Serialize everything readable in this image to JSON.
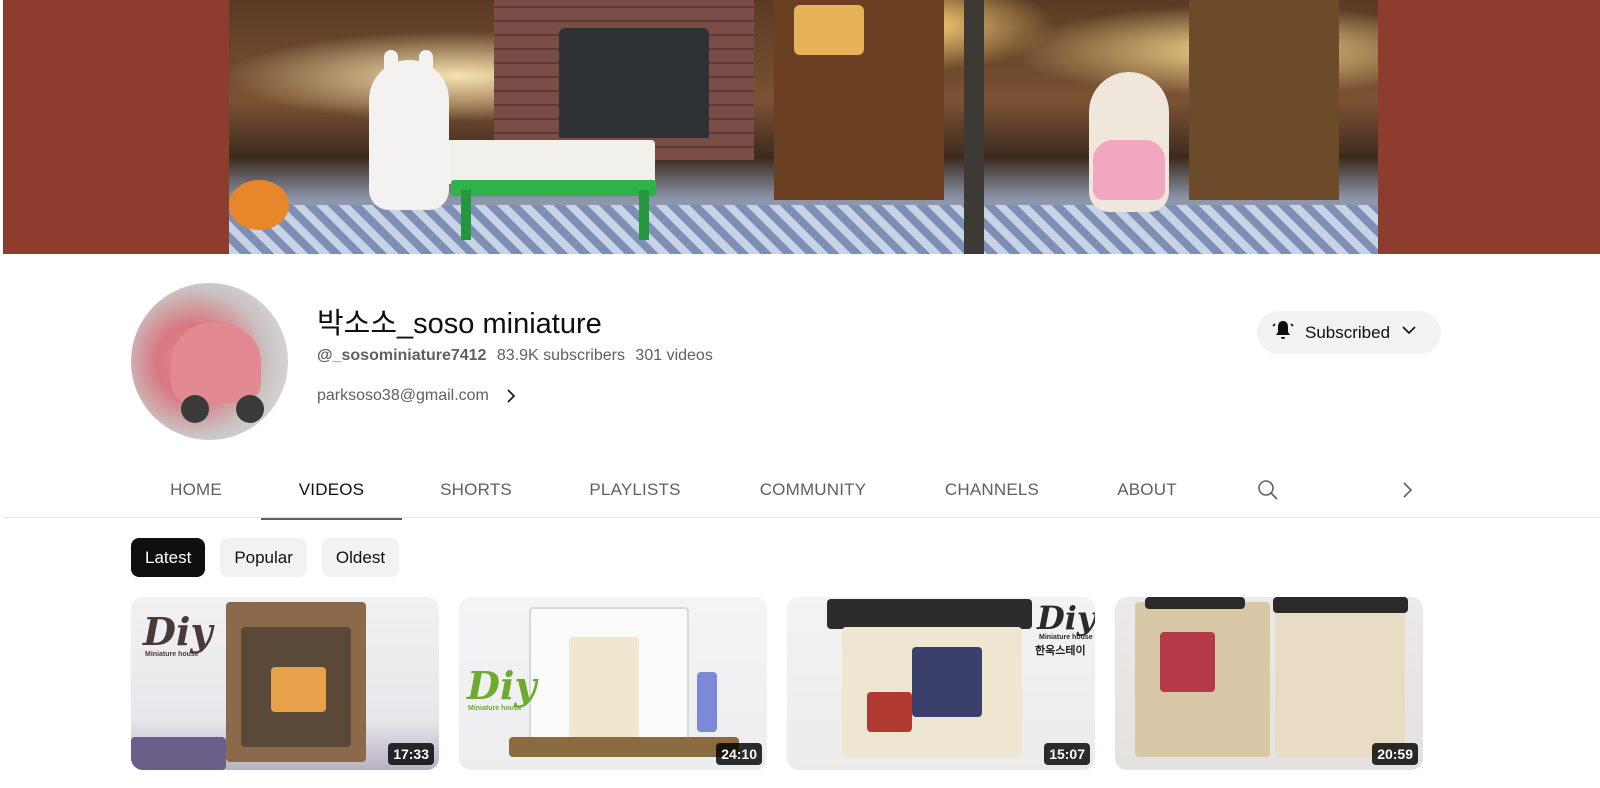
{
  "channel": {
    "name": "박소소_soso miniature",
    "handle": "@_sosominiature7412",
    "subscribers": "83.9K subscribers",
    "videos_count": "301 videos",
    "link": "parksoso38@gmail.com",
    "subscribe_label": "Subscribed"
  },
  "tabs": [
    {
      "label": "HOME"
    },
    {
      "label": "VIDEOS"
    },
    {
      "label": "SHORTS"
    },
    {
      "label": "PLAYLISTS"
    },
    {
      "label": "COMMUNITY"
    },
    {
      "label": "CHANNELS"
    },
    {
      "label": "ABOUT"
    }
  ],
  "active_tab": "VIDEOS",
  "chips": [
    {
      "label": "Latest"
    },
    {
      "label": "Popular"
    },
    {
      "label": "Oldest"
    }
  ],
  "active_chip": "Latest",
  "videos": [
    {
      "duration": "17:33",
      "badge": "Diy",
      "badge_sub": "Miniature house"
    },
    {
      "duration": "24:10",
      "badge": "Diy",
      "badge_sub": "Miniature house"
    },
    {
      "duration": "15:07",
      "badge": "Diy",
      "badge_sub": "Miniature house",
      "korean": "한옥스테이"
    },
    {
      "duration": "20:59"
    }
  ],
  "colors": {
    "banner_bg": "#8e3c2d",
    "chip_active_bg": "#0f0f0f",
    "chip_bg": "#f2f2f2",
    "tab_active_underline": "#606060",
    "subscribe_bg": "#f2f2f2"
  },
  "icons": {
    "subscribe": "bell-icon",
    "subscribe_dropdown": "chevron-down-icon",
    "link_more": "chevron-right-icon",
    "tab_search": "search-icon",
    "tab_next": "chevron-right-icon"
  }
}
